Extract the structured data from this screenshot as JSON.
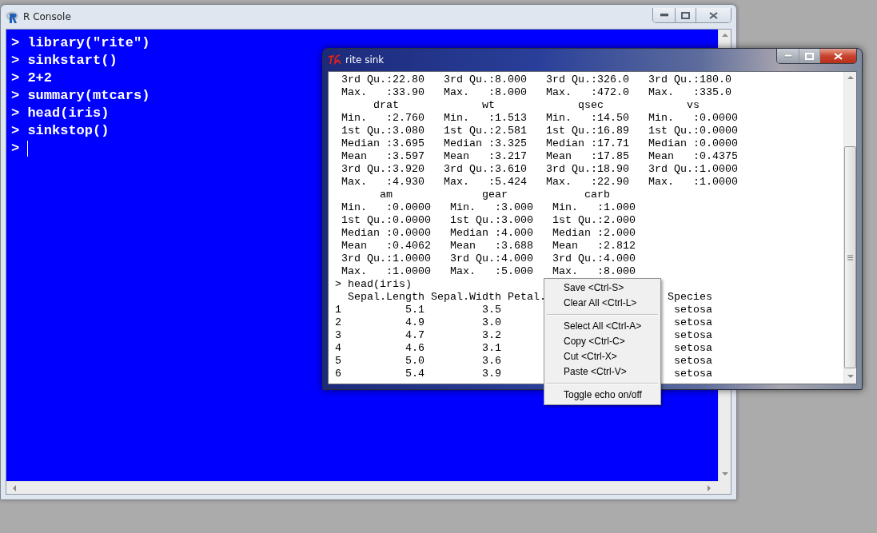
{
  "console_window": {
    "title": "R Console",
    "lines": [
      "> library(\"rite\")",
      "> sinkstart()",
      "> 2+2",
      "> summary(mtcars)",
      "> head(iris)",
      "> sinkstop()",
      ">"
    ]
  },
  "sink_window": {
    "title": "rite sink",
    "lines": [
      {
        "segments": [
          " 3rd Qu.:22.80   3rd Qu.:8.000   3rd Qu.:326.0   3rd Qu.:180.0"
        ]
      },
      {
        "segments": [
          " Max.   :33.90   Max.   :8.000   Max.   :472.0   Max.   :335.0"
        ]
      },
      {
        "segments": [
          "      drat             wt             qsec             vs"
        ]
      },
      {
        "segments": [
          " Min.   :2.760   Min.   :1.513   Min.   :14.50   Min.   :0.0000"
        ]
      },
      {
        "segments": [
          " 1st Qu.:3.080   1st Qu.:2.581   1st Qu.:16.89   1st Qu.:0.0000"
        ]
      },
      {
        "segments": [
          " Median :3.695   Median :3.325   Median :17.71   Median :0.0000"
        ]
      },
      {
        "segments": [
          " Mean   :3.597   Mean   :3.217   Mean   :17.85   Mean   :0.4375"
        ]
      },
      {
        "segments": [
          " 3rd Qu.:3.920   3rd Qu.:3.610   3rd Qu.:18.90   3rd Qu.:1.0000"
        ]
      },
      {
        "segments": [
          " Max.   :4.930   Max.   :5.424   Max.   :22.90   Max.   :1.0000"
        ]
      },
      {
        "segments": [
          "       am              gear            carb"
        ]
      },
      {
        "segments": [
          " Min.   :0.0000   Min.   :3.000   Min.   :1.000"
        ]
      },
      {
        "segments": [
          " 1st Qu.:0.0000   1st Qu.:3.000   1st Qu.:2.000"
        ]
      },
      {
        "segments": [
          " Median :0.0000   Median :4.000   Median :2.000"
        ]
      },
      {
        "segments": [
          " Mean   :0.4062   Mean   :3.688   Mean   :2.812"
        ]
      },
      {
        "segments": [
          " 3rd Qu.:1.0000   3rd Qu.:4.000   3rd Qu.:4.000"
        ]
      },
      {
        "segments": [
          " Max.   :1.0000   Max.   :5.000   Max.   :8.000"
        ]
      },
      {
        "segments": [
          "> head(iris)"
        ]
      },
      {
        "segments": [
          "  Sepal.Length Sepal.Width Petal.",
          "Species"
        ]
      },
      {
        "segments": [
          "1          5.1         3.5",
          "setosa"
        ]
      },
      {
        "segments": [
          "2          4.9         3.0",
          "setosa"
        ]
      },
      {
        "segments": [
          "3          4.7         3.2",
          "setosa"
        ]
      },
      {
        "segments": [
          "4          4.6         3.1",
          "setosa"
        ]
      },
      {
        "segments": [
          "5          5.0         3.6",
          "setosa"
        ]
      },
      {
        "segments": [
          "6          5.4         3.9",
          "setosa"
        ]
      }
    ]
  },
  "context_menu": {
    "sections": [
      {
        "items": [
          "Save <Ctrl-S>",
          "Clear All <Ctrl-L>"
        ]
      },
      {
        "items": [
          "Select All <Ctrl-A>",
          "Copy <Ctrl-C>",
          "Cut <Ctrl-X>",
          "Paste <Ctrl-V>"
        ]
      },
      {
        "items": [
          "Toggle echo on/off"
        ]
      }
    ]
  }
}
